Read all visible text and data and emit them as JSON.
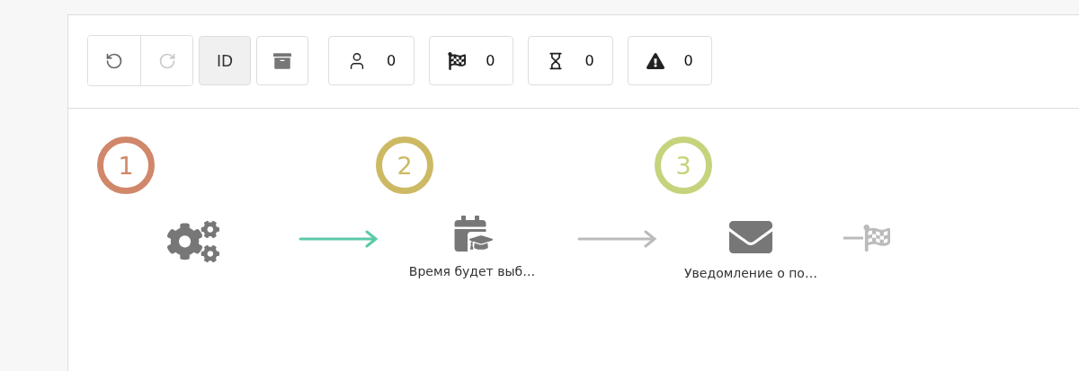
{
  "toolbar": {
    "history": [
      {
        "kind": "undo",
        "disabled": false
      },
      {
        "kind": "redo",
        "disabled": true
      }
    ],
    "id_toggle": {
      "label": "ID",
      "selected": true
    },
    "archive": {
      "kind": "archive"
    },
    "counters": [
      {
        "kind": "user",
        "value": "0"
      },
      {
        "kind": "finish",
        "value": "0"
      },
      {
        "kind": "waiting",
        "value": "0"
      },
      {
        "kind": "warning",
        "value": "0"
      }
    ]
  },
  "flow": {
    "steps": [
      {
        "number": "1",
        "color": "#d0876a",
        "kind": "gears"
      },
      {
        "number": "2",
        "color": "#cdb963",
        "kind": "calendar",
        "label": "Время будет выб…",
        "incoming_active": true
      },
      {
        "number": "3",
        "color": "#c6d37c",
        "kind": "envelope",
        "label": "Уведомление о по…",
        "incoming_active": false
      }
    ],
    "finish": {
      "active": false
    }
  }
}
